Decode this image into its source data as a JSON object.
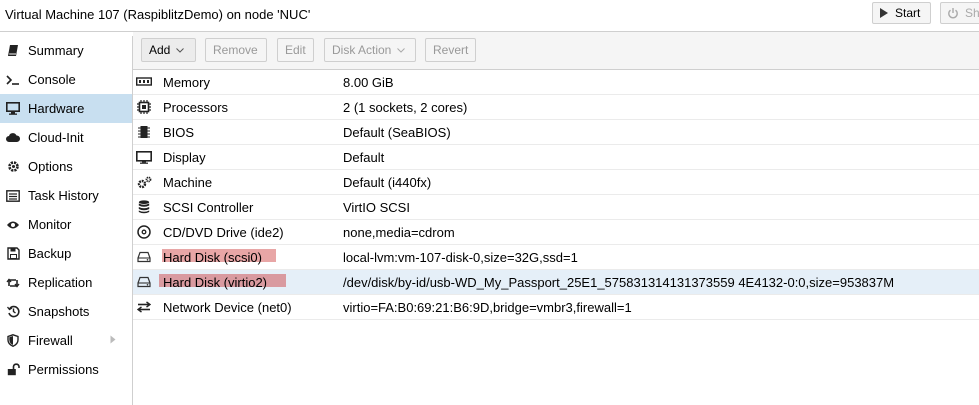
{
  "header": {
    "title": "Virtual Machine 107 (RaspiblitzDemo) on node 'NUC'",
    "start_label": "Start",
    "shutdown_label": "Sh"
  },
  "sidebar": {
    "items": [
      {
        "label": "Summary",
        "icon": "book-icon"
      },
      {
        "label": "Console",
        "icon": "terminal-icon"
      },
      {
        "label": "Hardware",
        "icon": "desktop-icon",
        "active": true
      },
      {
        "label": "Cloud-Init",
        "icon": "cloud-icon"
      },
      {
        "label": "Options",
        "icon": "gear-icon"
      },
      {
        "label": "Task History",
        "icon": "list-icon"
      },
      {
        "label": "Monitor",
        "icon": "eye-icon"
      },
      {
        "label": "Backup",
        "icon": "floppy-icon"
      },
      {
        "label": "Replication",
        "icon": "retweet-icon"
      },
      {
        "label": "Snapshots",
        "icon": "history-icon"
      },
      {
        "label": "Firewall",
        "icon": "shield-icon"
      },
      {
        "label": "Permissions",
        "icon": "unlock-icon"
      }
    ]
  },
  "toolbar": {
    "add": "Add",
    "remove": "Remove",
    "edit": "Edit",
    "disk_action": "Disk Action",
    "revert": "Revert"
  },
  "hardware": [
    {
      "name": "Memory",
      "value": "8.00 GiB",
      "icon": "memory-icon"
    },
    {
      "name": "Processors",
      "value": "2 (1 sockets, 2 cores)",
      "icon": "cpu-icon"
    },
    {
      "name": "BIOS",
      "value": "Default (SeaBIOS)",
      "icon": "microchip-icon"
    },
    {
      "name": "Display",
      "value": "Default",
      "icon": "display-icon"
    },
    {
      "name": "Machine",
      "value": "Default (i440fx)",
      "icon": "cogs-icon"
    },
    {
      "name": "SCSI Controller",
      "value": "VirtIO SCSI",
      "icon": "database-icon"
    },
    {
      "name": "CD/DVD Drive (ide2)",
      "value": "none,media=cdrom",
      "icon": "cdrom-icon"
    },
    {
      "name": "Hard Disk (scsi0)",
      "value": "local-lvm:vm-107-disk-0,size=32G,ssd=1",
      "icon": "hdd-icon"
    },
    {
      "name": "Hard Disk (virtio2)",
      "value": "/dev/disk/by-id/usb-WD_My_Passport_25E1_575831314131373559 4E4132-0:0,size=953837M",
      "icon": "hdd-icon",
      "selected": true
    },
    {
      "name": "Network Device (net0)",
      "value": "virtio=FA:B0:69:21:B6:9D,bridge=vmbr3,firewall=1",
      "icon": "exchange-icon"
    }
  ],
  "colors": {
    "active_nav": "#c8dff0",
    "selected_row": "#e5eff8",
    "highlight": "#e8a6a6"
  }
}
